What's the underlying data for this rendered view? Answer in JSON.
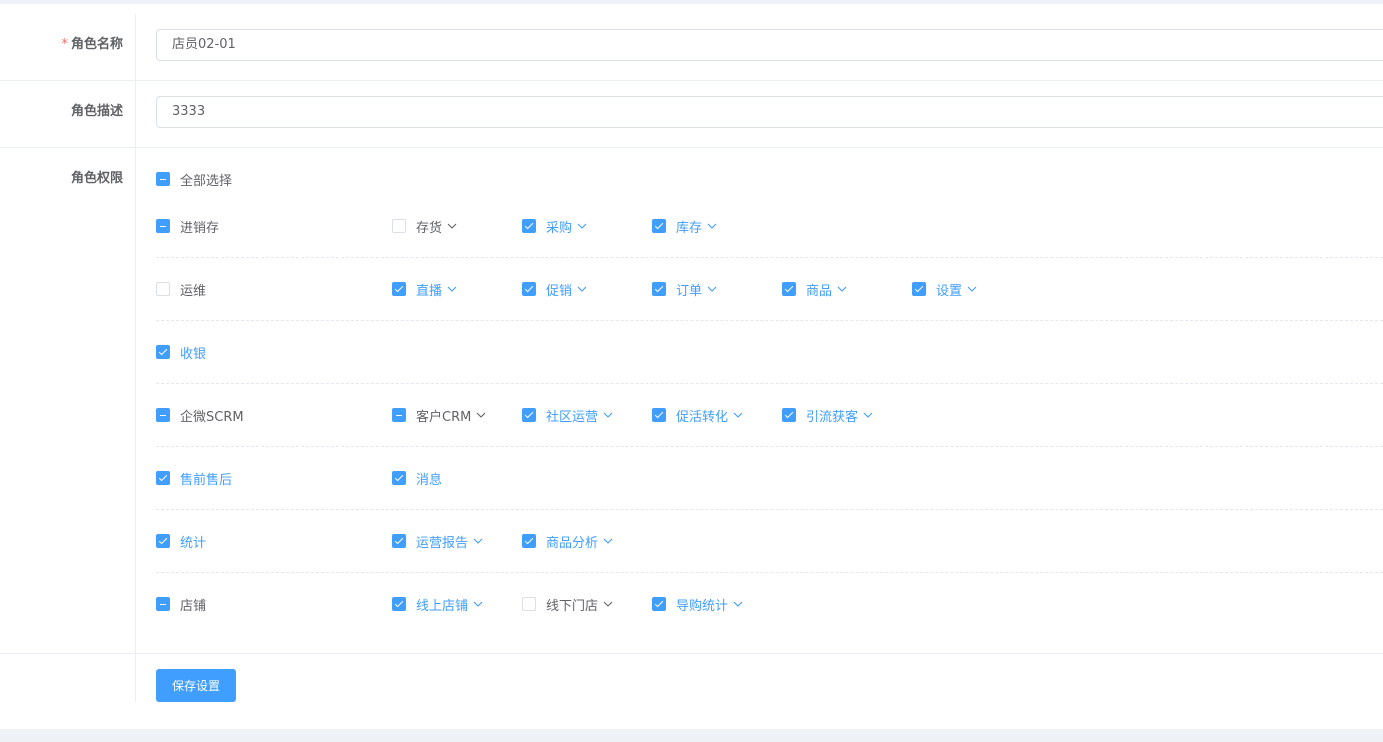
{
  "form": {
    "name_label": "角色名称",
    "name_required_mark": "*",
    "name_value": "店员02-01",
    "desc_label": "角色描述",
    "desc_value": "3333",
    "perm_label": "角色权限",
    "select_all": {
      "label": "全部选择",
      "state": "indeterminate"
    },
    "save_label": "保存设置"
  },
  "colors": {
    "accent": "#409eff",
    "required": "#f56c6c",
    "text": "#606266",
    "background": "#eef1f5"
  },
  "groups": [
    {
      "parent": {
        "label": "进销存",
        "state": "indeterminate"
      },
      "children": [
        {
          "label": "存货",
          "state": "unchecked",
          "dropdown": true
        },
        {
          "label": "采购",
          "state": "checked",
          "dropdown": true
        },
        {
          "label": "库存",
          "state": "checked",
          "dropdown": true
        }
      ]
    },
    {
      "parent": {
        "label": "运维",
        "state": "unchecked"
      },
      "children": [
        {
          "label": "直播",
          "state": "checked",
          "dropdown": true
        },
        {
          "label": "促销",
          "state": "checked",
          "dropdown": true
        },
        {
          "label": "订单",
          "state": "checked",
          "dropdown": true
        },
        {
          "label": "商品",
          "state": "checked",
          "dropdown": true
        },
        {
          "label": "设置",
          "state": "checked",
          "dropdown": true
        }
      ]
    },
    {
      "parent": {
        "label": "收银",
        "state": "checked"
      },
      "children": []
    },
    {
      "parent": {
        "label": "企微SCRM",
        "state": "indeterminate"
      },
      "children": [
        {
          "label": "客户CRM",
          "state": "indeterminate",
          "dropdown": true
        },
        {
          "label": "社区运营",
          "state": "checked",
          "dropdown": true
        },
        {
          "label": "促活转化",
          "state": "checked",
          "dropdown": true
        },
        {
          "label": "引流获客",
          "state": "checked",
          "dropdown": true
        }
      ]
    },
    {
      "parent": {
        "label": "售前售后",
        "state": "checked"
      },
      "children": [
        {
          "label": "消息",
          "state": "checked",
          "dropdown": false
        }
      ]
    },
    {
      "parent": {
        "label": "统计",
        "state": "checked"
      },
      "children": [
        {
          "label": "运营报告",
          "state": "checked",
          "dropdown": true
        },
        {
          "label": "商品分析",
          "state": "checked",
          "dropdown": true
        }
      ]
    },
    {
      "parent": {
        "label": "店铺",
        "state": "indeterminate"
      },
      "children": [
        {
          "label": "线上店铺",
          "state": "checked",
          "dropdown": true
        },
        {
          "label": "线下门店",
          "state": "unchecked",
          "dropdown": true
        },
        {
          "label": "导购统计",
          "state": "checked",
          "dropdown": true
        }
      ]
    }
  ]
}
